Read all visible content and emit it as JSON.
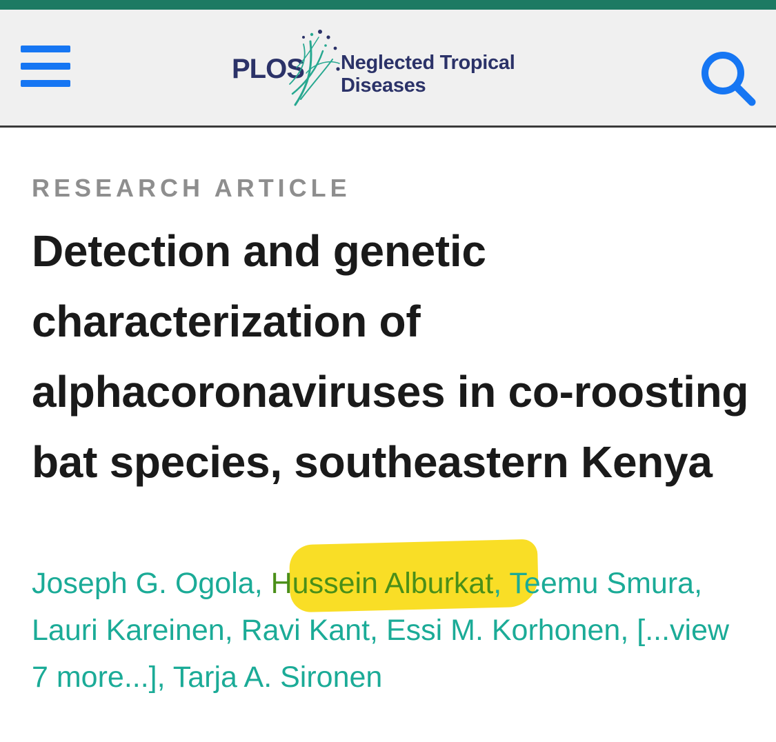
{
  "header": {
    "logo": {
      "brand": "PLOS",
      "journal_line1": "Neglected Tropical",
      "journal_line2": "Diseases"
    },
    "menu_icon": "hamburger-menu-icon",
    "search_icon": "search-icon"
  },
  "article": {
    "type": "RESEARCH ARTICLE",
    "title": "Detection and genetic characterization of alphacoronaviruses in co-roosting bat species, southeastern Kenya",
    "authors": [
      "Joseph G. Ogola",
      "Hussein Alburkat",
      "Teemu Smura",
      "Lauri Kareinen",
      "Ravi Kant",
      "Essi M. Korhonen",
      "[...view 7 more...]",
      "Tarja A. Sironen"
    ],
    "highlighted_author": "Hussein Alburkat"
  },
  "colors": {
    "top_stripe": "#1d7a63",
    "header_bg": "#f0f0f0",
    "icon_blue": "#1676f3",
    "logo_navy": "#2b3268",
    "author_teal": "#1bab97",
    "highlight_yellow": "#f9dc1a"
  }
}
